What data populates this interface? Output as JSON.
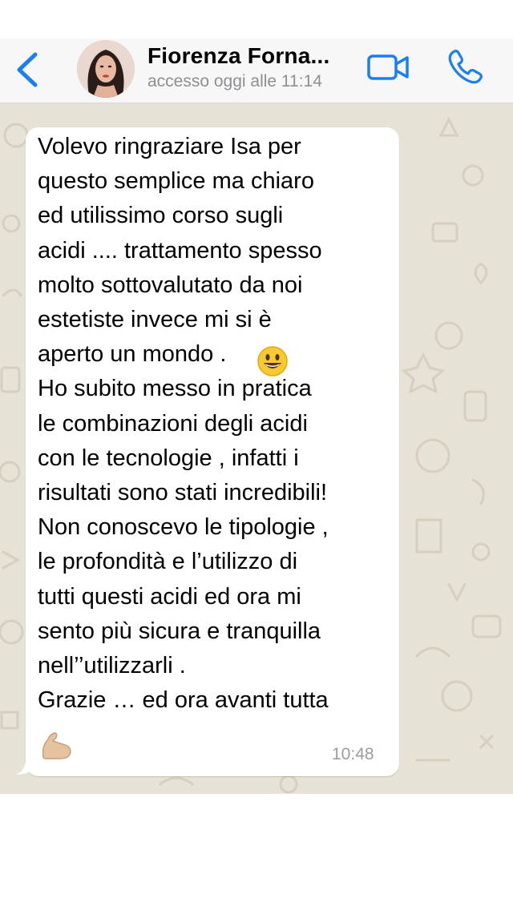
{
  "header": {
    "contact_name": "Fiorenza Forna...",
    "last_seen": "accesso oggi alle 11:14",
    "icons": {
      "back": "chevron-left-icon",
      "video": "video-camera-icon",
      "call": "phone-icon"
    },
    "accent_color": "#1a7ff0"
  },
  "message": {
    "text": "Volevo ringraziare Isa per\nquesto semplice ma chiaro\ned utilissimo  corso sugli\nacidi .... trattamento spesso\nmolto sottovalutato da noi\nestetiste invece mi si è\naperto un mondo       .\nHo subito messo in pratica\nle combinazioni degli acidi\ncon le tecnologie , infatti i\nrisultati sono stati incredibili!\nNon conoscevo le tipologie ,\nle profondità e l’utilizzo di\ntutti questi acidi ed ora mi\nsento più sicura e tranquilla\nnell’’utilizzarli .\nGrazie … ed ora avanti tutta",
    "time": "10:48",
    "emojis": [
      "smiling-face-emoji",
      "flexed-biceps-emoji"
    ]
  },
  "colors": {
    "chat_background": "#e7e2d6",
    "bubble": "#ffffff",
    "header_background": "#f7f7f7"
  }
}
